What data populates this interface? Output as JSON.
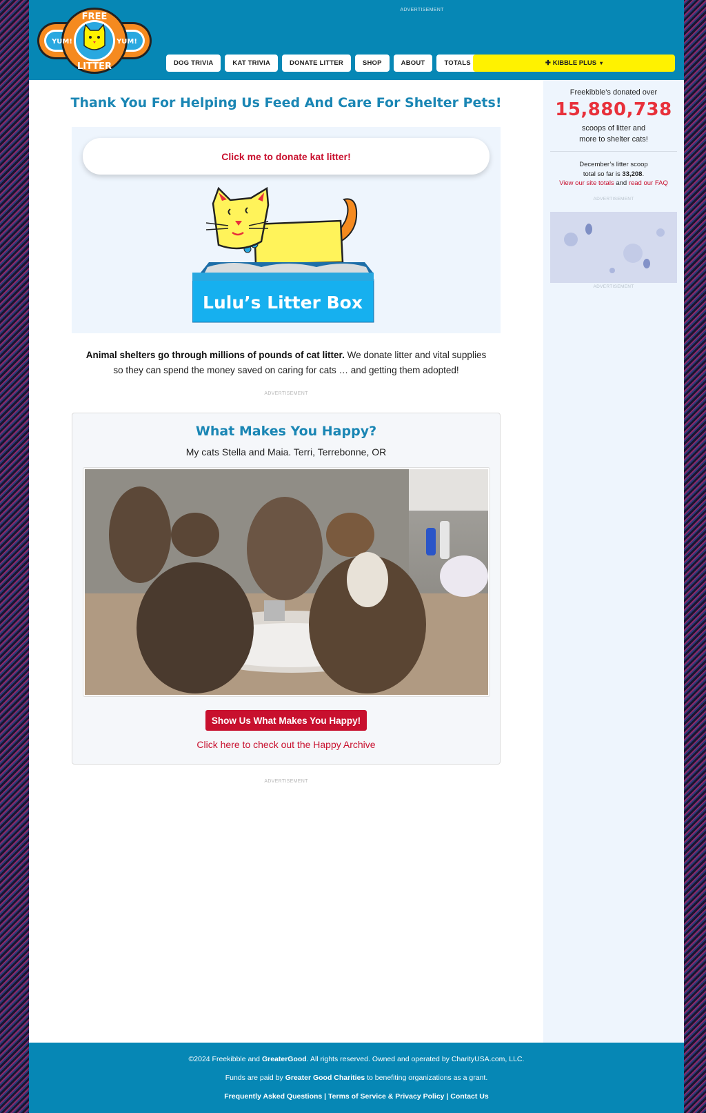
{
  "header": {
    "logo": {
      "top_text": "FREE",
      "bottom_text": "LITTER",
      "left_badge": "YUM!",
      "right_badge": "YUM!"
    },
    "ad_label": "ADVERTISEMENT",
    "nav": [
      {
        "label": "DOG TRIVIA"
      },
      {
        "label": "KAT TRIVIA"
      },
      {
        "label": "DONATE LITTER"
      },
      {
        "label": "SHOP"
      },
      {
        "label": "ABOUT"
      },
      {
        "label": "TOTALS"
      }
    ],
    "kibble_plus": {
      "icon": "plus-icon",
      "label": "KIBBLE PLUS",
      "caret": "▾"
    }
  },
  "main": {
    "headline": "Thank You For Helping Us Feed And Care For Shelter Pets!",
    "donate_button": "Click me to donate kat litter!",
    "litter_box_label": "Lulu’s Litter Box",
    "blurb_bold": "Animal shelters go through millions of pounds of cat litter.",
    "blurb_rest": " We donate litter and vital supplies so they can spend the money saved on caring for cats … and getting them adopted!",
    "ad_label_1": "ADVERTISEMENT",
    "ad_label_2": "ADVERTISEMENT",
    "happy": {
      "title": "What Makes You Happy?",
      "caption": "My cats Stella and Maia. Terri, Terrebonne, OR",
      "button": "Show Us What Makes You Happy!",
      "archive_link": "Click here to check out the Happy Archive"
    }
  },
  "sidebar": {
    "intro": "Freekibble’s donated over",
    "count": "15,880,738",
    "sub_line1": "scoops of litter and",
    "sub_line2": "more to shelter cats!",
    "month_line1": "December’s litter scoop",
    "month_line2_pre": "total so far is ",
    "month_value": "33,208",
    "month_line2_post": ".",
    "link_totals": "View our site totals",
    "link_join": " and ",
    "link_faq": "read our FAQ",
    "ad_label_top": "ADVERTISEMENT",
    "ad_label_bottom": "ADVERTISEMENT"
  },
  "footer": {
    "line1_pre": "©2024 Freekibble and ",
    "line1_bold": "GreaterGood",
    "line1_post": ". All rights reserved. Owned and operated by CharityUSA.com, LLC.",
    "line2_pre": "Funds are paid by ",
    "line2_bold": "Greater Good Charities",
    "line2_post": " to benefiting organizations as a grant.",
    "link_faq": "Frequently Asked Questions",
    "sep1": " | ",
    "link_tos": "Terms of Service & Privacy Policy",
    "sep2": " | ",
    "link_contact": "Contact Us"
  },
  "colors": {
    "header_blue": "#0687b5",
    "accent_red": "#c8102e",
    "count_red": "#e8303a",
    "kibble_yellow": "#fff200",
    "panel_bg": "#eef5fd"
  }
}
